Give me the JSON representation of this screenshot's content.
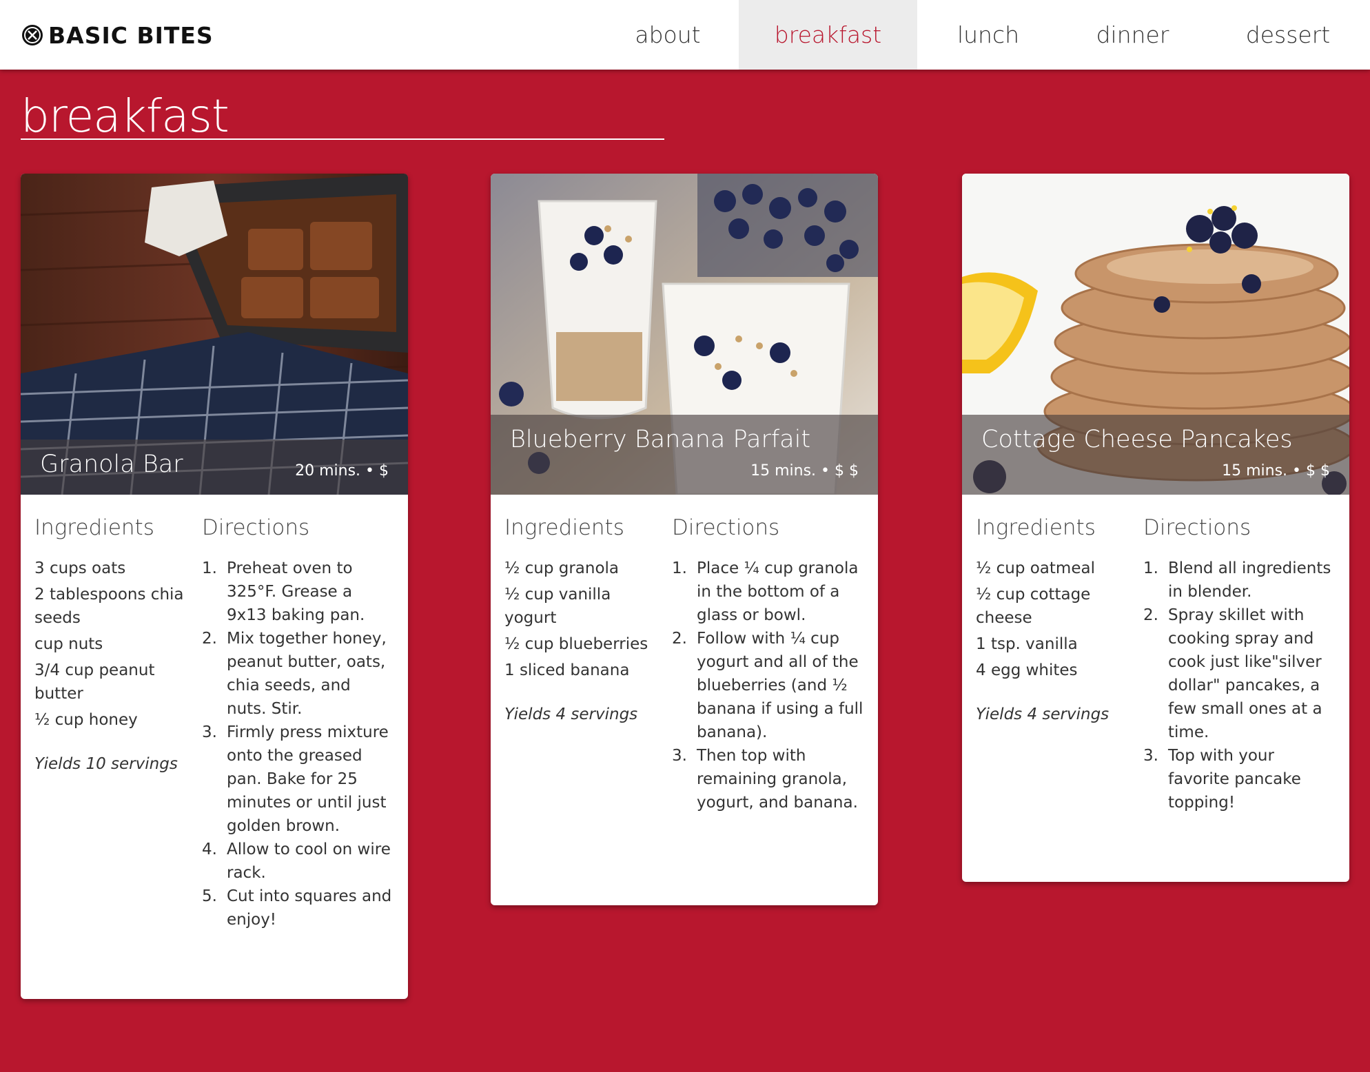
{
  "brand": {
    "name": "BASIC BITES"
  },
  "nav": [
    {
      "label": "about",
      "active": false
    },
    {
      "label": "breakfast",
      "active": true
    },
    {
      "label": "lunch",
      "active": false
    },
    {
      "label": "dinner",
      "active": false
    },
    {
      "label": "dessert",
      "active": false
    }
  ],
  "page": {
    "title": "breakfast"
  },
  "labels": {
    "ingredients": "Ingredients",
    "directions": "Directions"
  },
  "colors": {
    "accent": "#b8172e",
    "header_bg": "#ffffff",
    "nav_active_bg": "#ececec"
  },
  "recipes": [
    {
      "title": "Granola Bar",
      "meta": "20 mins. • $",
      "ingredients": [
        "3 cups oats",
        "2 tablespoons chia seeds",
        "cup nuts",
        "3/4 cup peanut butter",
        "½ cup honey"
      ],
      "yield": "Yields 10 servings",
      "directions": [
        "Preheat oven to 325°F. Grease a 9x13 baking pan.",
        "Mix together honey, peanut butter, oats, chia seeds, and nuts. Stir.",
        "Firmly press mixture onto the greased pan. Bake for 25 minutes or until just golden brown.",
        "Allow to cool on wire rack.",
        "Cut into squares and enjoy!"
      ]
    },
    {
      "title": "Blueberry Banana Parfait",
      "meta": "15 mins. • $ $",
      "ingredients": [
        "½ cup granola",
        "½ cup vanilla yogurt",
        "½ cup blueberries",
        "1 sliced banana"
      ],
      "yield": "Yields 4 servings",
      "directions": [
        "Place ¼ cup granola in the bottom of a glass or bowl.",
        "Follow with ¼ cup yogurt and all of the blueberries (and ½ banana if using a full banana).",
        "Then top with remaining granola, yogurt, and banana."
      ]
    },
    {
      "title": "Cottage Cheese Pancakes",
      "meta": "15 mins. • $ $",
      "ingredients": [
        "½ cup oatmeal",
        "½ cup cottage cheese",
        "1 tsp. vanilla",
        "4 egg whites"
      ],
      "yield": "Yields 4 servings",
      "directions": [
        "Blend all ingredients in blender.",
        "Spray skillet with cooking spray and cook just like\"silver dollar\" pancakes, a few small ones at a time.",
        "Top with your favorite pancake topping!"
      ]
    }
  ]
}
